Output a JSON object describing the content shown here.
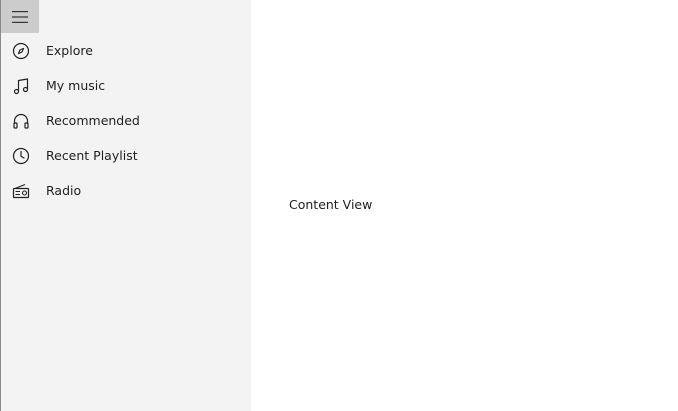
{
  "nav": {
    "menu_icon": "hamburger-menu-icon",
    "items": [
      {
        "label": "Explore",
        "icon": "compass-icon"
      },
      {
        "label": "My music",
        "icon": "music-note-icon"
      },
      {
        "label": "Recommended",
        "icon": "headphones-icon"
      },
      {
        "label": "Recent Playlist",
        "icon": "clock-icon"
      },
      {
        "label": "Radio",
        "icon": "radio-icon"
      }
    ]
  },
  "content": {
    "label": "Content View"
  },
  "colors": {
    "pane_background": "#f3f3f3",
    "menu_button_background": "#cccccc",
    "content_background": "#ffffff",
    "text": "#1f1f1f"
  }
}
